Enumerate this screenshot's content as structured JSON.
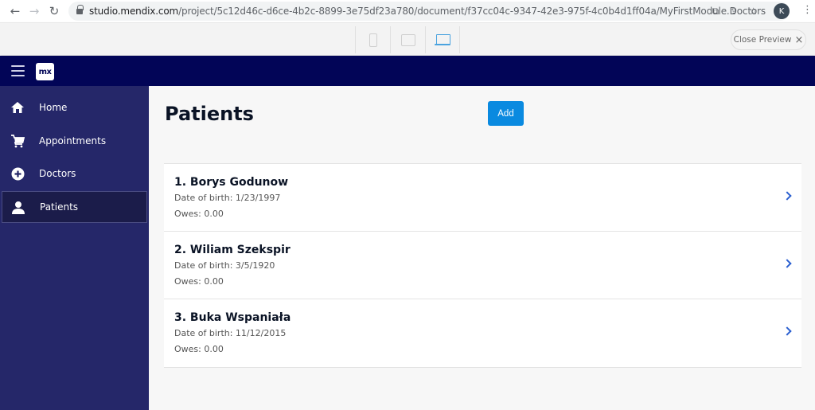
{
  "browser": {
    "url_host": "studio.mendix.com",
    "url_path": "/project/5c12d46c-d6ce-4b2c-8899-3e75df23a780/document/f37cc04c-9347-42e3-975f-4c0b4d1ff04a/MyFirstModule.Doctors",
    "profile_initial": "K"
  },
  "preview": {
    "devices": [
      "phone",
      "tablet",
      "desktop"
    ],
    "active_device": "desktop",
    "close_label": "Close Preview"
  },
  "app": {
    "logo_text": "mx"
  },
  "sidebar": {
    "items": [
      {
        "label": "Home",
        "icon": "home-icon"
      },
      {
        "label": "Appointments",
        "icon": "cart-icon"
      },
      {
        "label": "Doctors",
        "icon": "plus-circle-icon"
      },
      {
        "label": "Patients",
        "icon": "user-icon",
        "active": true
      }
    ]
  },
  "main": {
    "title": "Patients",
    "add_label": "Add",
    "patients": [
      {
        "name": "1. Borys Godunow",
        "dob": "Date of birth: 1/23/1997",
        "owes": "Owes: 0.00"
      },
      {
        "name": "2. Wiliam Szekspir",
        "dob": "Date of birth: 3/5/1920",
        "owes": "Owes: 0.00"
      },
      {
        "name": "3. Buka Wspaniała",
        "dob": "Date of birth: 11/12/2015",
        "owes": "Owes: 0.00"
      }
    ]
  },
  "colors": {
    "topbar": "#020557",
    "sidebar": "#252769",
    "accent": "#0a8ae0"
  }
}
